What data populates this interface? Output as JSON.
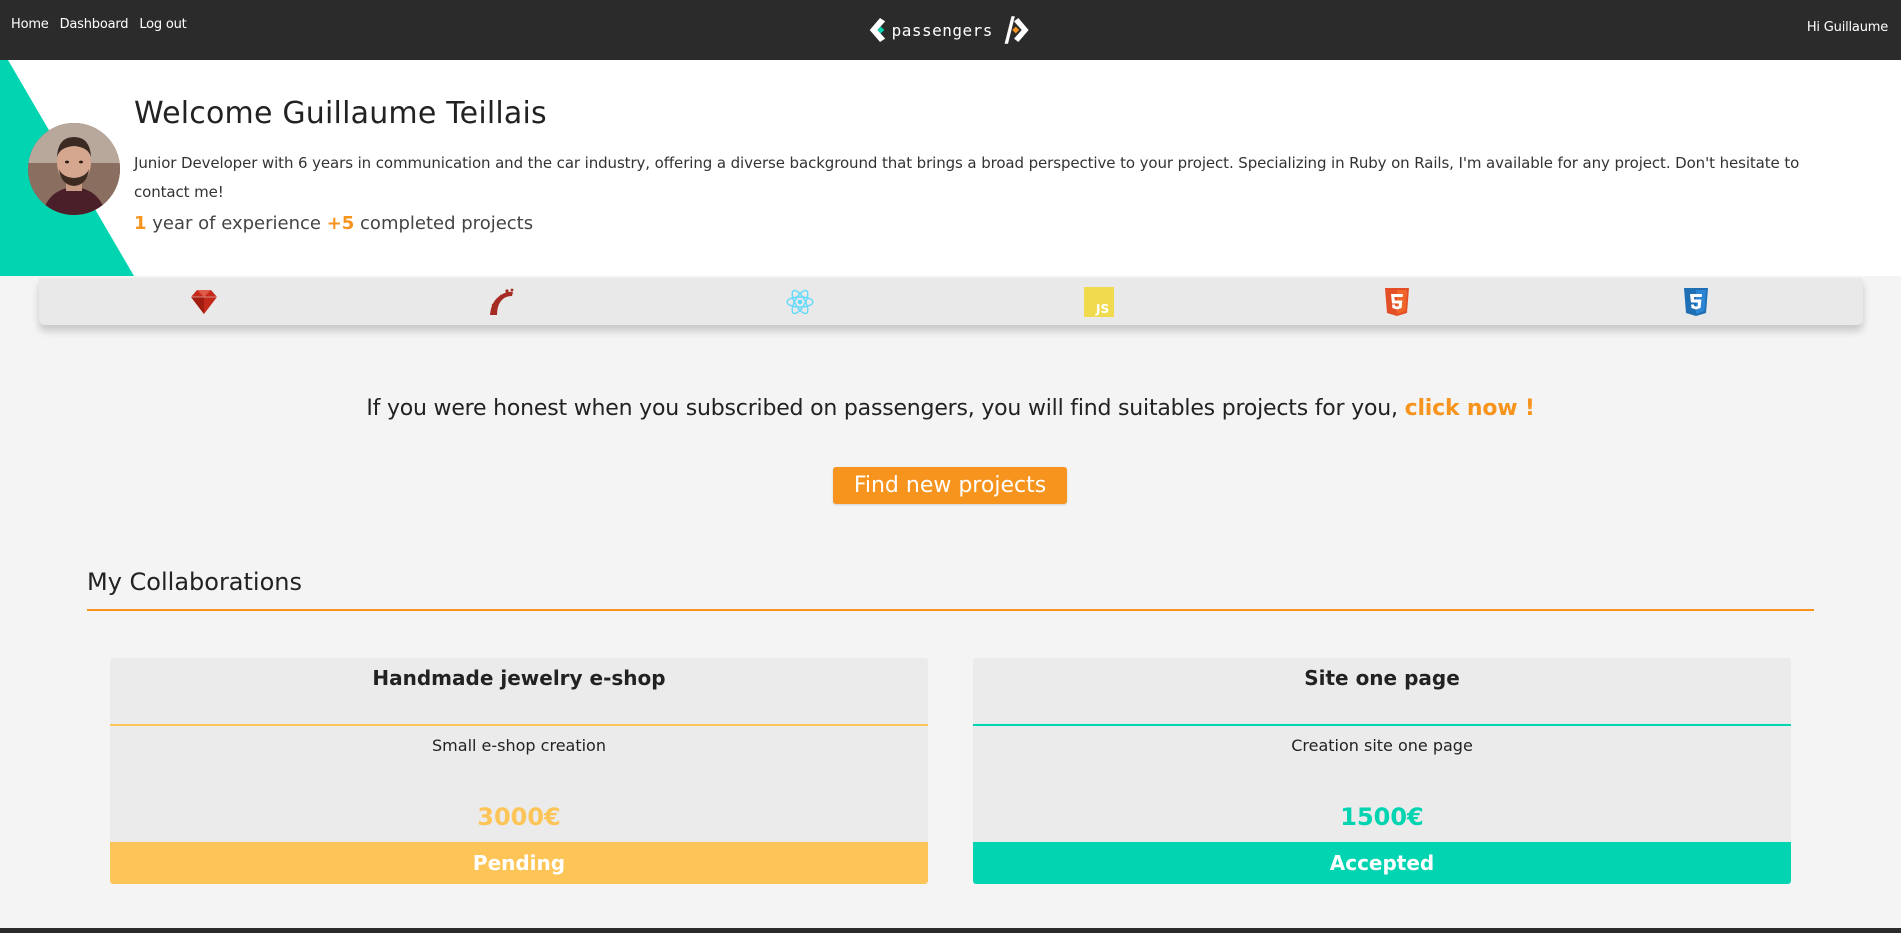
{
  "nav": {
    "links": [
      "Home",
      "Dashboard",
      "Log out"
    ],
    "logo_text": "passengers",
    "greeting": "Hi Guillaume"
  },
  "profile": {
    "welcome": "Welcome Guillaume Teillais",
    "bio": "Junior Developer with 6 years in communication and the car industry, offering a diverse background that brings a broad perspective to your project. Specializing in Ruby on Rails, I'm available for any project. Don't hesitate to contact me!",
    "experience_value": "1",
    "experience_text": " year of experience ",
    "projects_value": "+5",
    "projects_text": " completed projects"
  },
  "skills": [
    {
      "icon": "ruby-icon",
      "color": "#b52a1c"
    },
    {
      "icon": "rails-icon",
      "color": "#a62c23"
    },
    {
      "icon": "react-icon",
      "color": "#61dafb"
    },
    {
      "icon": "javascript-icon",
      "color": "#f0db4f"
    },
    {
      "icon": "html5-icon",
      "color": "#e34f26"
    },
    {
      "icon": "css3-icon",
      "color": "#1f6fb5"
    }
  ],
  "cta": {
    "text": "If you were honest when you subscribed on passengers, you will find suitables projects for you, ",
    "link": "click now !",
    "button": "Find new projects"
  },
  "collaborations": {
    "title": "My Collaborations",
    "items": [
      {
        "title": "Handmade jewelry e-shop",
        "description": "Small e-shop creation",
        "price": "3000€",
        "status": "Pending",
        "color": "#fdc557"
      },
      {
        "title": "Site one page",
        "description": "Creation site one page",
        "price": "1500€",
        "status": "Accepted",
        "color": "#00d4b0"
      }
    ]
  },
  "colors": {
    "accent": "#f7941d",
    "teal": "#00d4b0",
    "navbar": "#2b2b2b"
  }
}
